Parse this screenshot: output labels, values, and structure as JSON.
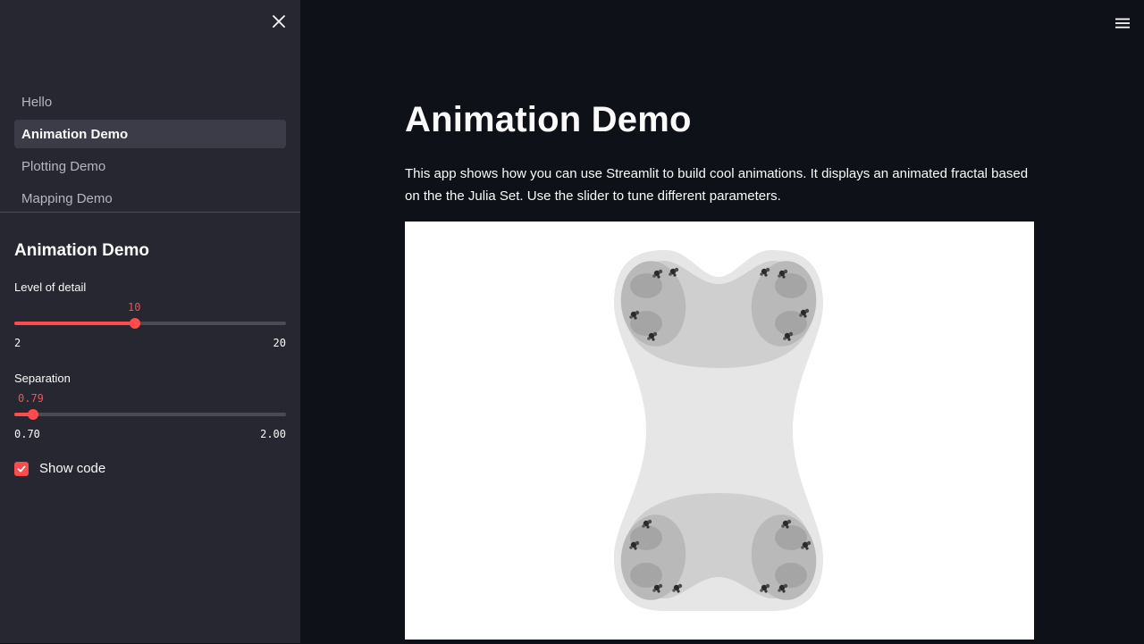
{
  "sidebar": {
    "nav_items": [
      {
        "label": "Hello",
        "active": false
      },
      {
        "label": "Animation Demo",
        "active": true
      },
      {
        "label": "Plotting Demo",
        "active": false
      },
      {
        "label": "Mapping Demo",
        "active": false
      }
    ],
    "section_title": "Animation Demo",
    "sliders": [
      {
        "label": "Level of detail",
        "value": "10",
        "min": "2",
        "max": "20"
      },
      {
        "label": "Separation",
        "value": "0.79",
        "min": "0.70",
        "max": "2.00"
      }
    ],
    "checkbox": {
      "label": "Show code",
      "checked": true
    }
  },
  "main": {
    "title": "Animation Demo",
    "description": "This app shows how you can use Streamlit to build cool animations. It displays an animated fractal based on the the Julia Set. Use the slider to tune different parameters."
  },
  "icons": {
    "close": "close-icon",
    "menu": "hamburger-menu-icon",
    "check": "checkmark-icon"
  },
  "colors": {
    "accent": "#ff4b4b",
    "sidebar_bg": "#262730",
    "main_bg": "#0e1117"
  }
}
